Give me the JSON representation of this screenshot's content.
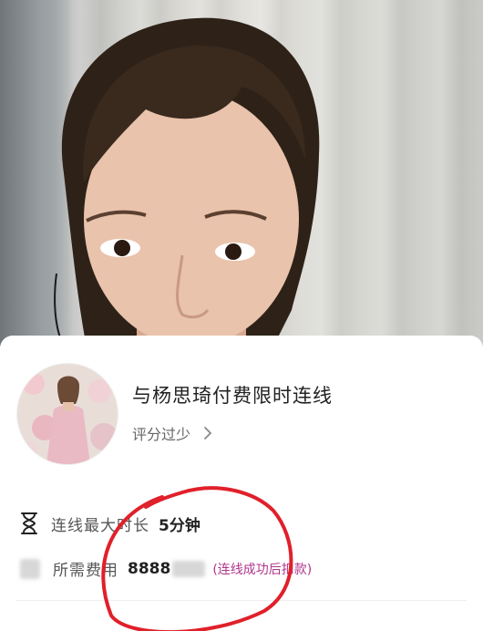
{
  "sheet": {
    "title": "与杨思琦付费限时连线",
    "rating_text": "评分过少",
    "duration": {
      "label": "连线最大时长",
      "value": "5分钟"
    },
    "fee": {
      "label": "所需费用",
      "value": "8888",
      "note": "(连线成功后扣款)"
    }
  },
  "colors": {
    "accent_note": "#b0358b",
    "annotation_red": "#e0202a"
  },
  "icons": [
    "hourglass-icon",
    "chevron-right-icon"
  ]
}
